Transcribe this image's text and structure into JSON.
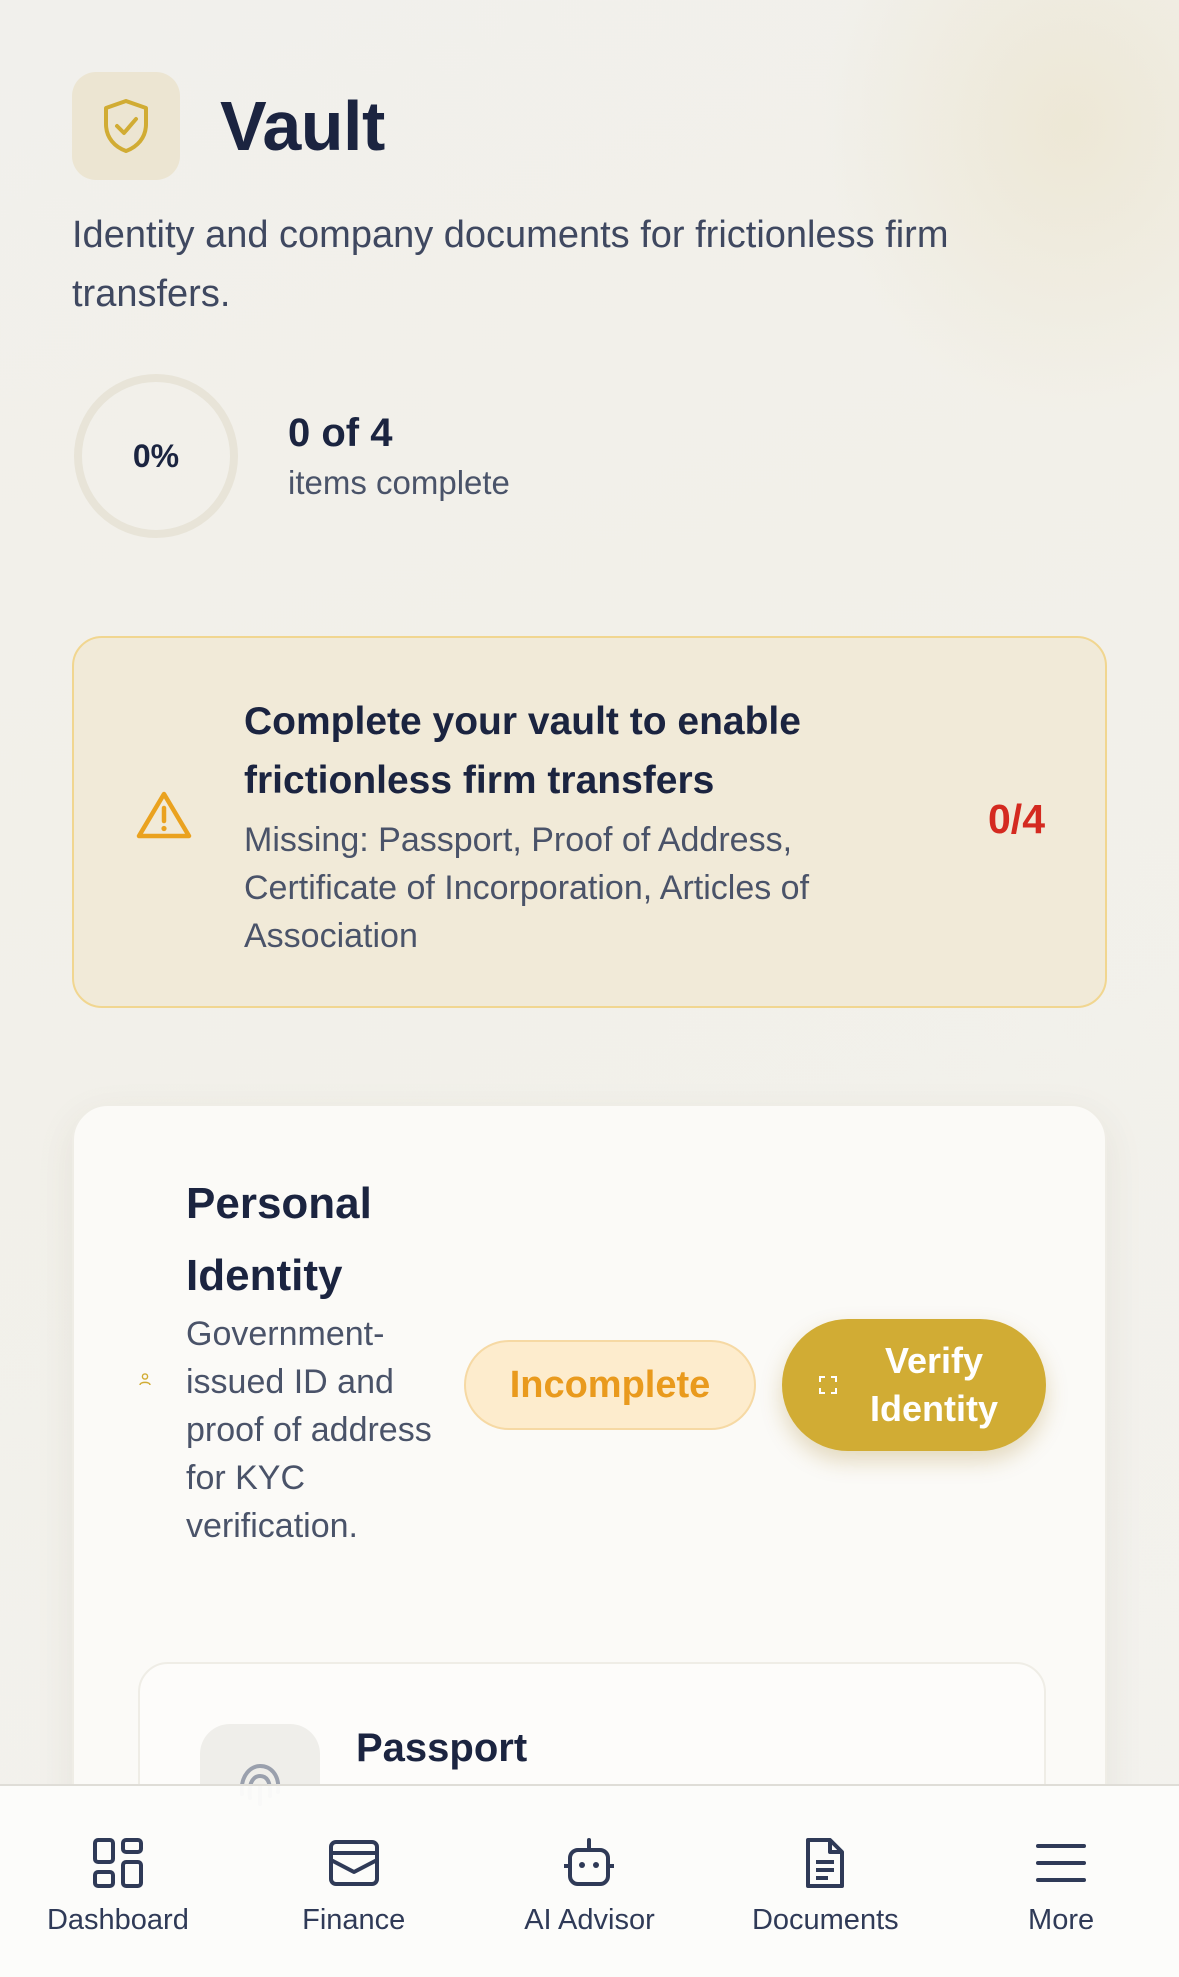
{
  "page": {
    "title": "Vault",
    "subtitle": "Identity and company documents for frictionless firm transfers.",
    "icon": "shield-check-icon"
  },
  "progress": {
    "percent_label": "0%",
    "percent_value": 0,
    "count_label": "0 of 4",
    "sub_label": "items complete"
  },
  "alert": {
    "icon": "warning-triangle-icon",
    "title": "Complete your vault to enable frictionless firm transfers",
    "body": "Missing: Passport, Proof of Address, Certificate of Incorporation, Articles of Association",
    "count": "0/4",
    "count_color": "#d42a20"
  },
  "section": {
    "icon": "person-icon",
    "title": "Personal Identity",
    "description": "Government-issued ID and proof of address for KYC verification.",
    "status": "Incomplete",
    "action_label": "Verify Identity",
    "action_icon": "scan-icon"
  },
  "documents": [
    {
      "icon": "fingerprint-icon",
      "title": "Passport"
    }
  ],
  "nav": [
    {
      "label": "Dashboard",
      "icon": "grid-icon"
    },
    {
      "label": "Finance",
      "icon": "wallet-icon"
    },
    {
      "label": "AI Advisor",
      "icon": "robot-icon"
    },
    {
      "label": "Documents",
      "icon": "document-icon"
    },
    {
      "label": "More",
      "icon": "menu-icon"
    }
  ],
  "colors": {
    "accent": "#d1ac34",
    "text_primary": "#1b2440",
    "warning": "#e99a1d",
    "danger": "#d42a20"
  }
}
